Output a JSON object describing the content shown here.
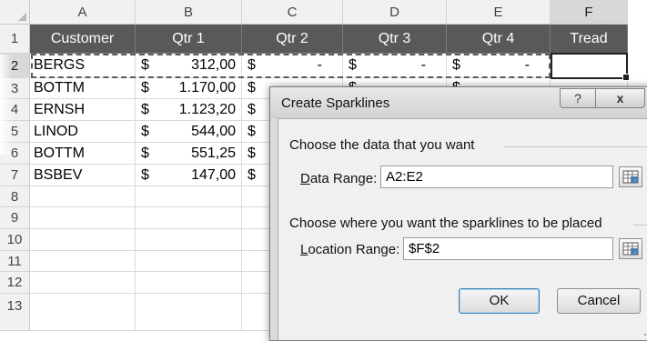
{
  "sheet": {
    "column_headers": [
      "A",
      "B",
      "C",
      "D",
      "E",
      "F"
    ],
    "row_numbers": [
      "1",
      "2",
      "3",
      "4",
      "5",
      "6",
      "7",
      "8",
      "9",
      "10",
      "11",
      "12",
      "13"
    ],
    "header_row": [
      "Customer",
      "Qtr 1",
      "Qtr 2",
      "Qtr 3",
      "Qtr 4",
      "Tread"
    ],
    "currency_symbol": "$",
    "empty_value": "-",
    "rows": [
      {
        "customer": "BERGS",
        "qtr1": "312,00"
      },
      {
        "customer": "BOTTM",
        "qtr1": "1.170,00"
      },
      {
        "customer": "ERNSH",
        "qtr1": "1.123,20"
      },
      {
        "customer": "LINOD",
        "qtr1": "544,00"
      },
      {
        "customer": "BOTTM",
        "qtr1": "551,25"
      },
      {
        "customer": "BSBEV",
        "qtr1": "147,00"
      }
    ],
    "selected_cell": "F2",
    "copy_marquee_range": "A2:E2"
  },
  "dialog": {
    "title": "Create Sparklines",
    "help_label": "?",
    "close_label": "x",
    "section1_label": "Choose the data that you want",
    "data_range_label_accel": "D",
    "data_range_label_rest": "ata Range:",
    "data_range_value": "A2:E2",
    "section2_label": "Choose where you want the sparklines to be placed",
    "location_range_label_accel": "L",
    "location_range_label_rest": "ocation Range:",
    "location_range_value": "$F$2",
    "ok_label": "OK",
    "cancel_label": "Cancel"
  },
  "colors": {
    "header_fill": "#595959",
    "header_text": "#ffffff",
    "default_button_border": "#3c7fb1"
  }
}
